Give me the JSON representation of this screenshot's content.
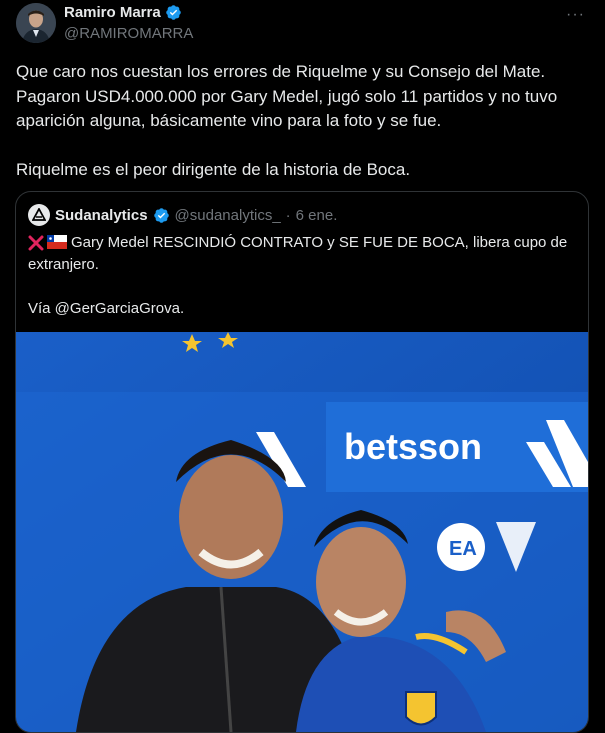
{
  "author": {
    "name": "Ramiro Marra",
    "handle": "@RAMIROMARRA",
    "verified_icon": "verified-badge-icon",
    "more_label": "···"
  },
  "tweet": {
    "text": "Que caro nos cuestan los errores de Riquelme y su Consejo del Mate. Pagaron USD4.000.000 por Gary Medel, jugó solo 11 partidos y no tuvo aparición alguna, básicamente vino para la foto y se fue.\n\nRiquelme es el peor dirigente de la historia de Boca."
  },
  "quoted": {
    "name": "Sudanalytics",
    "handle": "@sudanalytics_",
    "separator": "·",
    "date": "6 ene.",
    "flags": [
      "cross-mark-icon",
      "chile-flag-icon"
    ],
    "text": "Gary Medel RESCINDIÓ CONTRATO y SE FUE DE BOCA, libera cupo de extranjero.\n\nVía @GerGarciaGrova.",
    "image": {
      "sponsor_text": "betsson",
      "ea_text": "EA",
      "description_icon": "photo-riquelme-medel"
    }
  },
  "colors": {
    "background": "#000000",
    "text": "#e7e9ea",
    "secondary": "#71767b",
    "verified": "#1d9bf0",
    "border": "#2f3336",
    "boca_blue": "#1f5fc4"
  }
}
